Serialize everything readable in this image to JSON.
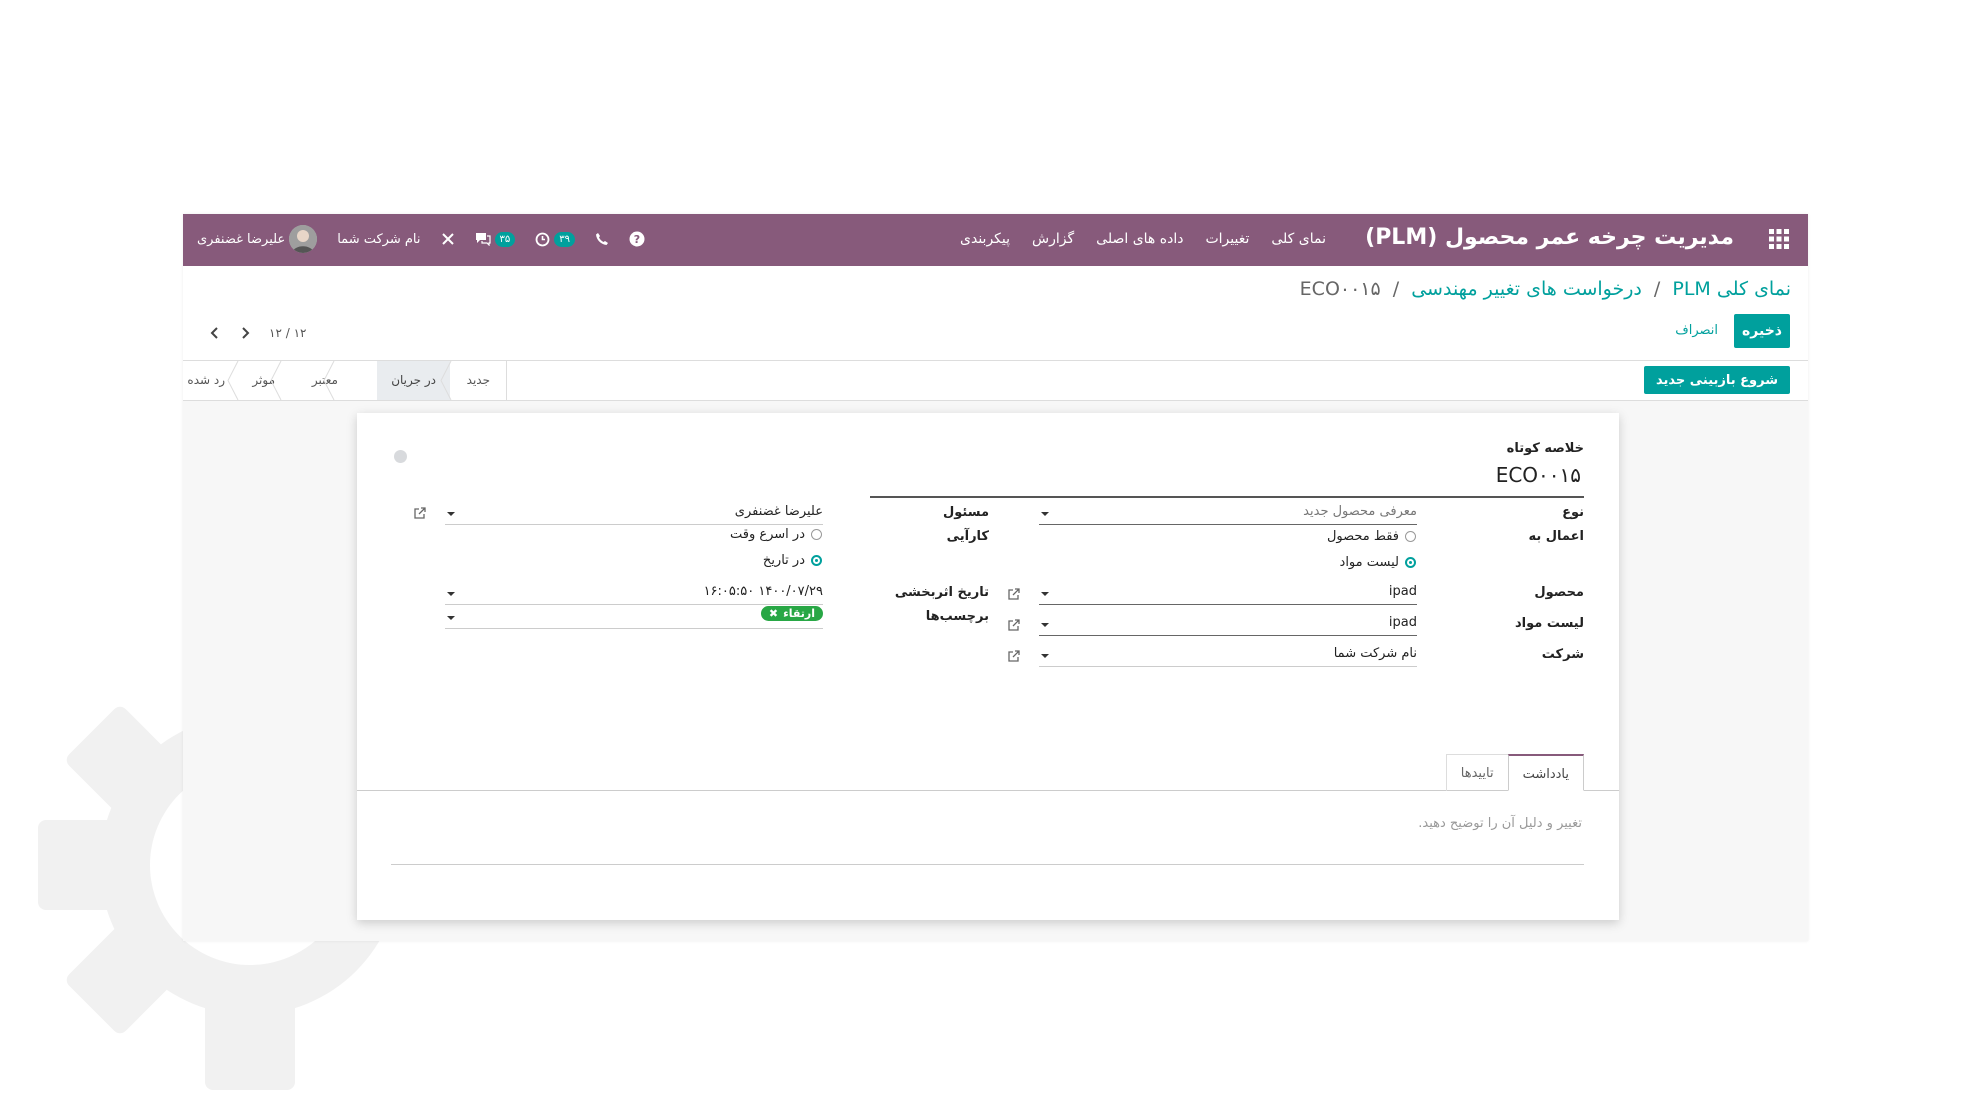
{
  "topbar": {
    "app_title": "مدیریت چرخه عمر محصول (PLM)",
    "menu": [
      "نمای کلی",
      "تغییرات",
      "داده های اصلی",
      "گزارش",
      "پیکربندی"
    ],
    "user_name": "علیرضا غضنفری",
    "company_name": "نام شرکت شما",
    "activities_count": "۳۹",
    "messages_count": "۳۵"
  },
  "breadcrumb": {
    "root": "نمای کلی PLM",
    "parent": "درخواست های تغییر مهندسی",
    "current": "ECO۰۰۱۵",
    "separator": "/"
  },
  "buttons": {
    "save": "ذخیره",
    "discard": "انصراف",
    "new_revision": "شروع بازبینی جدید"
  },
  "pager": {
    "value": "۱۲ / ۱۲"
  },
  "stages": [
    {
      "label": "جدید",
      "active": false
    },
    {
      "label": "در جریان",
      "active": true
    },
    {
      "label": "معتبر",
      "active": false
    },
    {
      "label": "موثر",
      "active": false
    },
    {
      "label": "رد شده",
      "active": false
    }
  ],
  "form": {
    "summary_label": "خلاصه کوتاه",
    "summary_value": "ECO۰۰۱۵",
    "type_label": "نوع",
    "type_value": "معرفی محصول جدید",
    "apply_on_label": "اعمال به",
    "apply_on_options": [
      "فقط محصول",
      "لیست مواد"
    ],
    "apply_on_selected": "لیست مواد",
    "product_label": "محصول",
    "product_value": "ipad",
    "bom_label": "لیست مواد",
    "bom_value": "ipad",
    "company_label": "شرکت",
    "company_value": "نام شرکت شما",
    "responsible_label": "مسئول",
    "responsible_value": "علیرضا غضنفری",
    "effectivity_label": "کارآیی",
    "effectivity_options": [
      "در اسرع وقت",
      "در تاریخ"
    ],
    "effectivity_selected": "در تاریخ",
    "effective_date_label": "تاریخ اثربخشی",
    "effective_date_value": "۱۴۰۰/۰۷/۲۹ ۱۶:۰۵:۵۰",
    "tags_label": "برچسب‌ها",
    "tags": [
      "ارتقاء"
    ]
  },
  "tabs": [
    "یادداشت",
    "تاییدها"
  ],
  "active_tab": "یادداشت",
  "note_placeholder": "تغییر و دلیل آن را توضیح دهید.",
  "colors": {
    "primary": "#875a7b",
    "accent": "#00a09d",
    "tag_green": "#28a745"
  }
}
